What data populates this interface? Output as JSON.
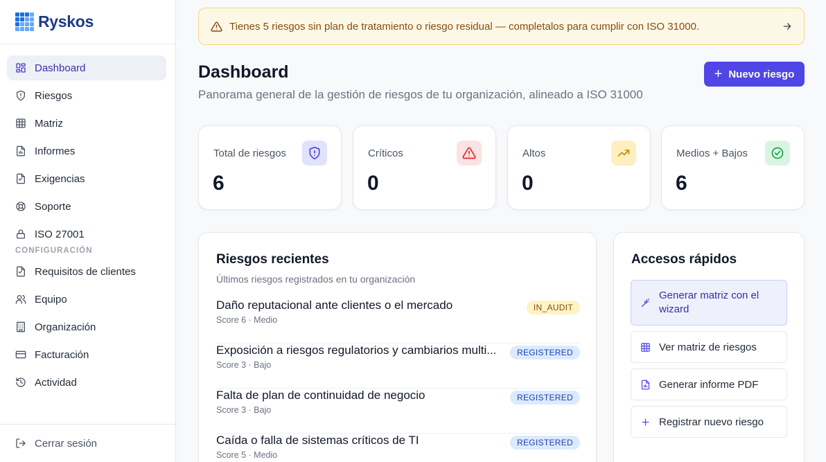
{
  "brand": {
    "name": "Ryskos"
  },
  "sidebar": {
    "items": [
      {
        "label": "Dashboard",
        "icon": "dashboard-icon",
        "active": true
      },
      {
        "label": "Riesgos",
        "icon": "shield-icon"
      },
      {
        "label": "Matriz",
        "icon": "grid-icon"
      },
      {
        "label": "Informes",
        "icon": "report-icon"
      },
      {
        "label": "Exigencias",
        "icon": "document-icon"
      },
      {
        "label": "Soporte",
        "icon": "lifebuoy-icon"
      },
      {
        "label": "ISO 27001",
        "icon": "lock-icon"
      }
    ],
    "section_label": "CONFIGURACIÓN",
    "config_items": [
      {
        "label": "Requisitos de clientes",
        "icon": "document-icon"
      },
      {
        "label": "Equipo",
        "icon": "users-icon"
      },
      {
        "label": "Organización",
        "icon": "building-icon"
      },
      {
        "label": "Facturación",
        "icon": "credit-card-icon"
      },
      {
        "label": "Actividad",
        "icon": "history-icon"
      }
    ],
    "logout_label": "Cerrar sesión"
  },
  "alert": {
    "text": "Tienes 5 riesgos sin plan de tratamiento o riesgo residual — completalos para cumplir con ISO 31000.",
    "color": "#854d0e"
  },
  "header": {
    "title": "Dashboard",
    "subtitle": "Panorama general de la gestión de riesgos de tu organización, alineado a ISO 31000",
    "new_button_label": "Nuevo riesgo",
    "accent": "#4f46e5"
  },
  "stats": [
    {
      "label": "Total de riesgos",
      "value": "6",
      "icon": "shield-alert-icon",
      "color": "#4f46e5"
    },
    {
      "label": "Críticos",
      "value": "0",
      "icon": "warning-triangle-icon",
      "color": "#dc2626"
    },
    {
      "label": "Altos",
      "value": "0",
      "icon": "trending-up-icon",
      "color": "#ca8a04"
    },
    {
      "label": "Medios + Bajos",
      "value": "6",
      "icon": "check-circle-icon",
      "color": "#16a34a"
    }
  ],
  "recent": {
    "title": "Riesgos recientes",
    "subtitle": "Últimos riesgos registrados en tu organización",
    "rows": [
      {
        "title": "Daño reputacional ante clientes o el mercado",
        "meta": "Score 6 · Medio",
        "status": "IN_AUDIT"
      },
      {
        "title": "Exposición a riesgos regulatorios y cambiarios multi...",
        "meta": "Score 3 · Bajo",
        "status": "REGISTERED"
      },
      {
        "title": "Falta de plan de continuidad de negocio",
        "meta": "Score 3 · Bajo",
        "status": "REGISTERED"
      },
      {
        "title": "Caída o falla de sistemas críticos de TI",
        "meta": "Score 5 · Medio",
        "status": "REGISTERED"
      }
    ]
  },
  "quick": {
    "title": "Accesos rápidos",
    "actions": [
      {
        "label": "Generar matriz con el wizard",
        "icon": "magic-wand-icon"
      },
      {
        "label": "Ver matriz de riesgos",
        "icon": "grid-icon"
      },
      {
        "label": "Generar informe PDF",
        "icon": "pdf-file-icon"
      },
      {
        "label": "Registrar nuevo riesgo",
        "icon": "plus-icon"
      }
    ]
  }
}
